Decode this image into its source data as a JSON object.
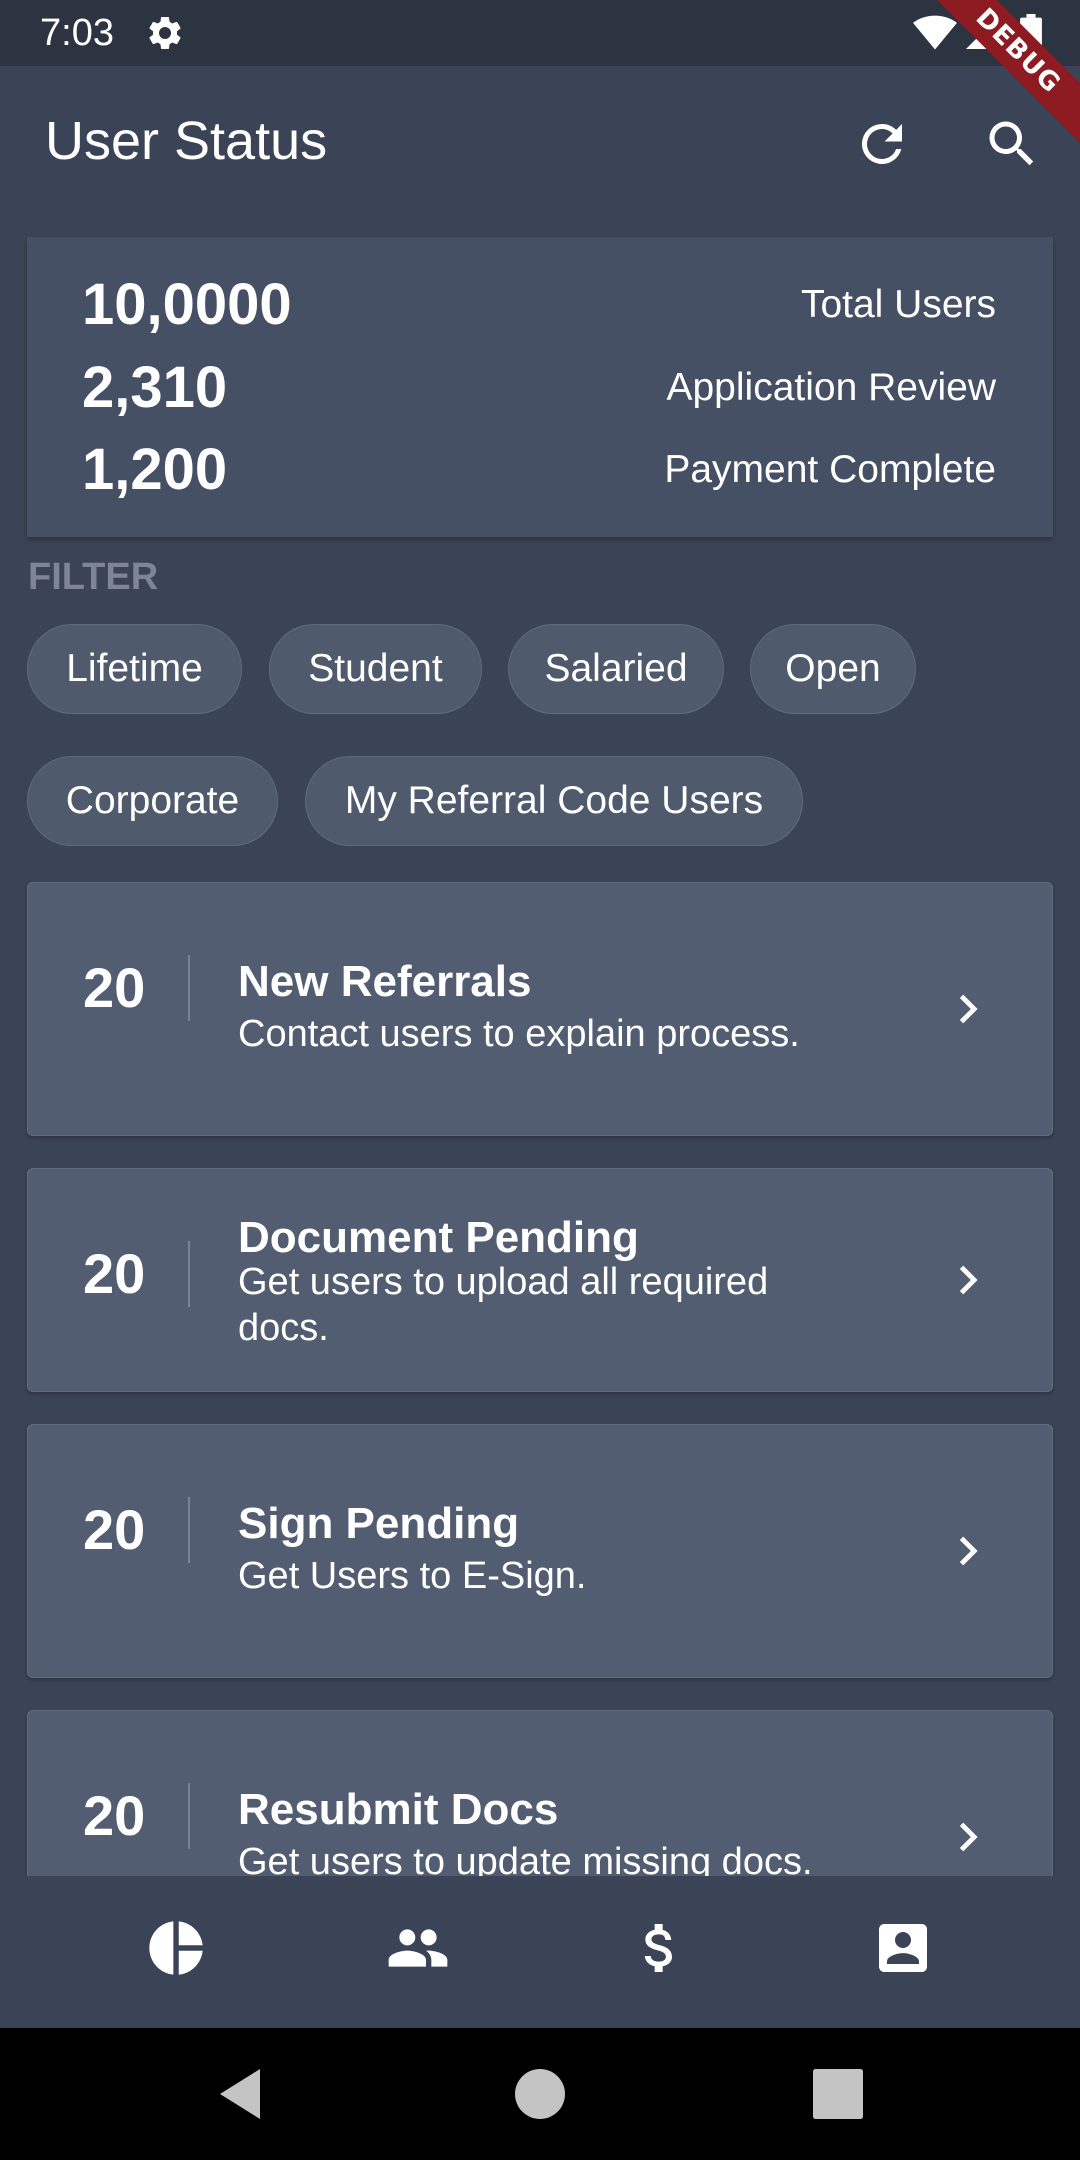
{
  "status_bar": {
    "time": "7:03",
    "debug_label": "DEBUG"
  },
  "app_bar": {
    "title": "User Status",
    "refresh_icon": "refresh-icon",
    "search_icon": "search-icon"
  },
  "stats": [
    {
      "value": "10,0000",
      "label": "Total Users"
    },
    {
      "value": "2,310",
      "label": "Application Review"
    },
    {
      "value": "1,200",
      "label": "Payment Complete"
    }
  ],
  "filter": {
    "label": "FILTER",
    "chips": [
      "Lifetime",
      "Student",
      "Salaried",
      "Open",
      "Corporate",
      "My Referral Code Users"
    ]
  },
  "items": [
    {
      "count": "20",
      "title": "New Referrals",
      "subtitle": "Contact users to explain process."
    },
    {
      "count": "20",
      "title": "Document Pending",
      "subtitle": "Get users to upload all required docs."
    },
    {
      "count": "20",
      "title": "Sign Pending",
      "subtitle": "Get Users to E-Sign."
    },
    {
      "count": "20",
      "title": "Resubmit Docs",
      "subtitle": "Get users to update missing docs."
    }
  ],
  "bottom_nav": [
    "pie-chart-icon",
    "people-icon",
    "dollar-icon",
    "contact-card-icon"
  ],
  "colors": {
    "background": "#3b4456",
    "card": "#455064",
    "list_card": "#525d71",
    "chip": "#4f5a6d",
    "filter_label": "#7d8596",
    "debug_banner": "#8e1a22"
  }
}
